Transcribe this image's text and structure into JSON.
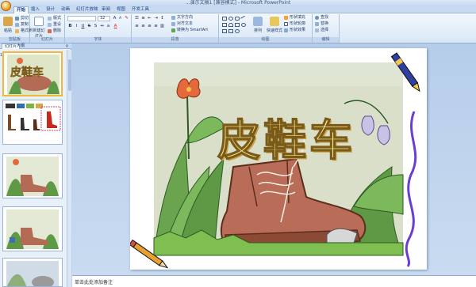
{
  "window": {
    "title": "...演示文稿1 [兼容模式] - Microsoft PowerPoint"
  },
  "tabs": [
    {
      "label": "开始",
      "active": true
    },
    {
      "label": "插入"
    },
    {
      "label": "设计"
    },
    {
      "label": "动画"
    },
    {
      "label": "幻灯片放映"
    },
    {
      "label": "审阅"
    },
    {
      "label": "视图"
    },
    {
      "label": "开发工具"
    }
  ],
  "ribbon": {
    "clipboard": {
      "paste": "粘贴",
      "cut": "剪切",
      "copy": "复制",
      "format_painter": "格式刷",
      "label": "剪贴板"
    },
    "slides": {
      "new_slide": "新建幻灯片",
      "layout": "版式",
      "reset": "重设",
      "delete": "删除",
      "label": "幻灯片"
    },
    "font": {
      "label": "字体",
      "size": "32"
    },
    "paragraph": {
      "label": "段落",
      "text_direction": "文字方向",
      "align_text": "对齐文本",
      "smartart": "转换为 SmartArt"
    },
    "drawing": {
      "label": "绘图",
      "arrange": "排列",
      "quick_styles": "快速样式",
      "fill": "形状填充",
      "outline": "形状轮廓",
      "effects": "形状效果"
    },
    "editing": {
      "label": "编辑",
      "find": "查找",
      "replace": "替换",
      "select": "选择"
    }
  },
  "left_panel": {
    "tabs": [
      "幻灯片",
      "大纲"
    ],
    "thumbnail_title": "皮鞋车"
  },
  "slide": {
    "title": "皮鞋车"
  },
  "notes": {
    "placeholder": "单击此处添加备注"
  },
  "colors": {
    "title_fill": "#f8ef86",
    "title_stroke": "#7a5a1a",
    "accent_orange": "#f3a52d",
    "ribbon_blue": "#c8daf0"
  }
}
